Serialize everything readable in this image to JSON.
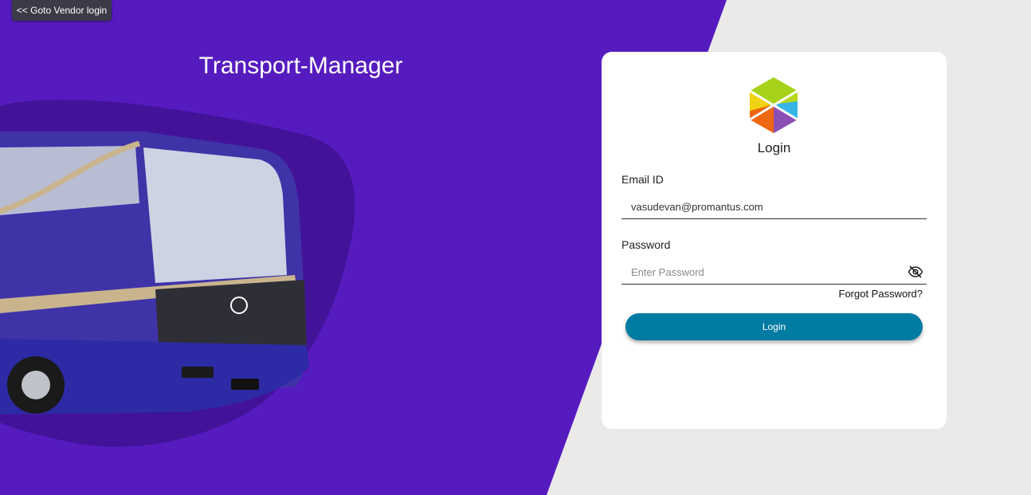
{
  "nav": {
    "vendor_login_label": "<< Goto Vendor login"
  },
  "app": {
    "title": "Transport-Manager"
  },
  "login": {
    "heading": "Login",
    "email_label": "Email ID",
    "email_value": "vasudevan@promantus.com",
    "password_label": "Password",
    "password_placeholder": "Enter Password",
    "forgot_label": "Forgot Password?",
    "submit_label": "Login"
  },
  "icons": {
    "password_toggle": "eye-off-icon",
    "brand": "cube-logo-icon"
  },
  "colors": {
    "left_panel": "#561bbf",
    "right_background": "#ebeae8",
    "login_button": "#007ba2"
  }
}
